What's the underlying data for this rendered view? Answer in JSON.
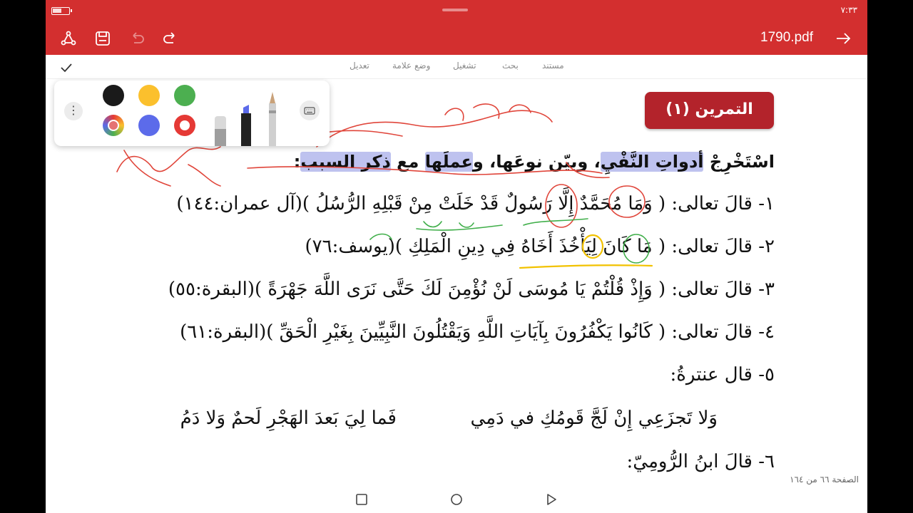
{
  "status": {
    "time": "٧:٣٣"
  },
  "toolbar": {
    "file_name": "1790.pdf"
  },
  "tabs": [
    {
      "label": "مستند"
    },
    {
      "label": "بحث"
    },
    {
      "label": "تشغيل"
    },
    {
      "label": "وضع علامة"
    },
    {
      "label": "تعديل"
    }
  ],
  "palette": {
    "more_label": "⋮",
    "colors": [
      "#1a1a1a",
      "#fbc02d",
      "#4caf50",
      "#5c6bea",
      "#e53935"
    ]
  },
  "document": {
    "exercise_title": "التمرين (١)",
    "instruction": {
      "part1": "اسْتَخْرِجْ ",
      "part2": "أدواتِ النَّفْيِ",
      "part3": "، وبيّن نوعَها",
      "part4": "، و",
      "part5": "عملَها",
      "part6": " مع ",
      "part7": "ذكر السبب",
      "part8": ":"
    },
    "lines": [
      "١- قالَ تعالى: ( وَمَا مُحَمَّدٌ إِلَّا رَسُولٌ قَدْ خَلَتْ مِنْ قَبْلِهِ الرُّسُلُ )(آل عمران:١٤٤)",
      "٢- قالَ تعالى: ( مَا كَانَ لِيَأْخُذَ أَخَاهُ فِي دِينِ الْمَلِكِ )(يوسف:٧٦)",
      "٣- قالَ تعالى: ( وَإِذْ قُلْتُمْ يَا مُوسَى لَنْ نُؤْمِنَ لَكَ حَتَّى نَرَى اللَّهَ جَهْرَةً )(البقرة:٥٥)",
      "٤- قالَ تعالى: ( كَانُوا يَكْفُرُونَ بِآيَاتِ اللَّهِ وَيَقْتُلُونَ النَّبِيِّينَ بِغَيْرِ الْحَقِّ )(البقرة:٦١)",
      "٥- قال عنترةُ:",
      "٦- قالَ ابنُ الرُّومِيّ:"
    ],
    "poem": {
      "right": "وَلا تَجزَعِي إِنْ لَجَّ قَومُكِ في دَمِي",
      "left": "فَما لِيَ بَعدَ الهَجْرِ لَحمٌ وَلا دَمُ"
    },
    "page_indicator": "الصفحة ٦٦ من ١٦٤"
  }
}
